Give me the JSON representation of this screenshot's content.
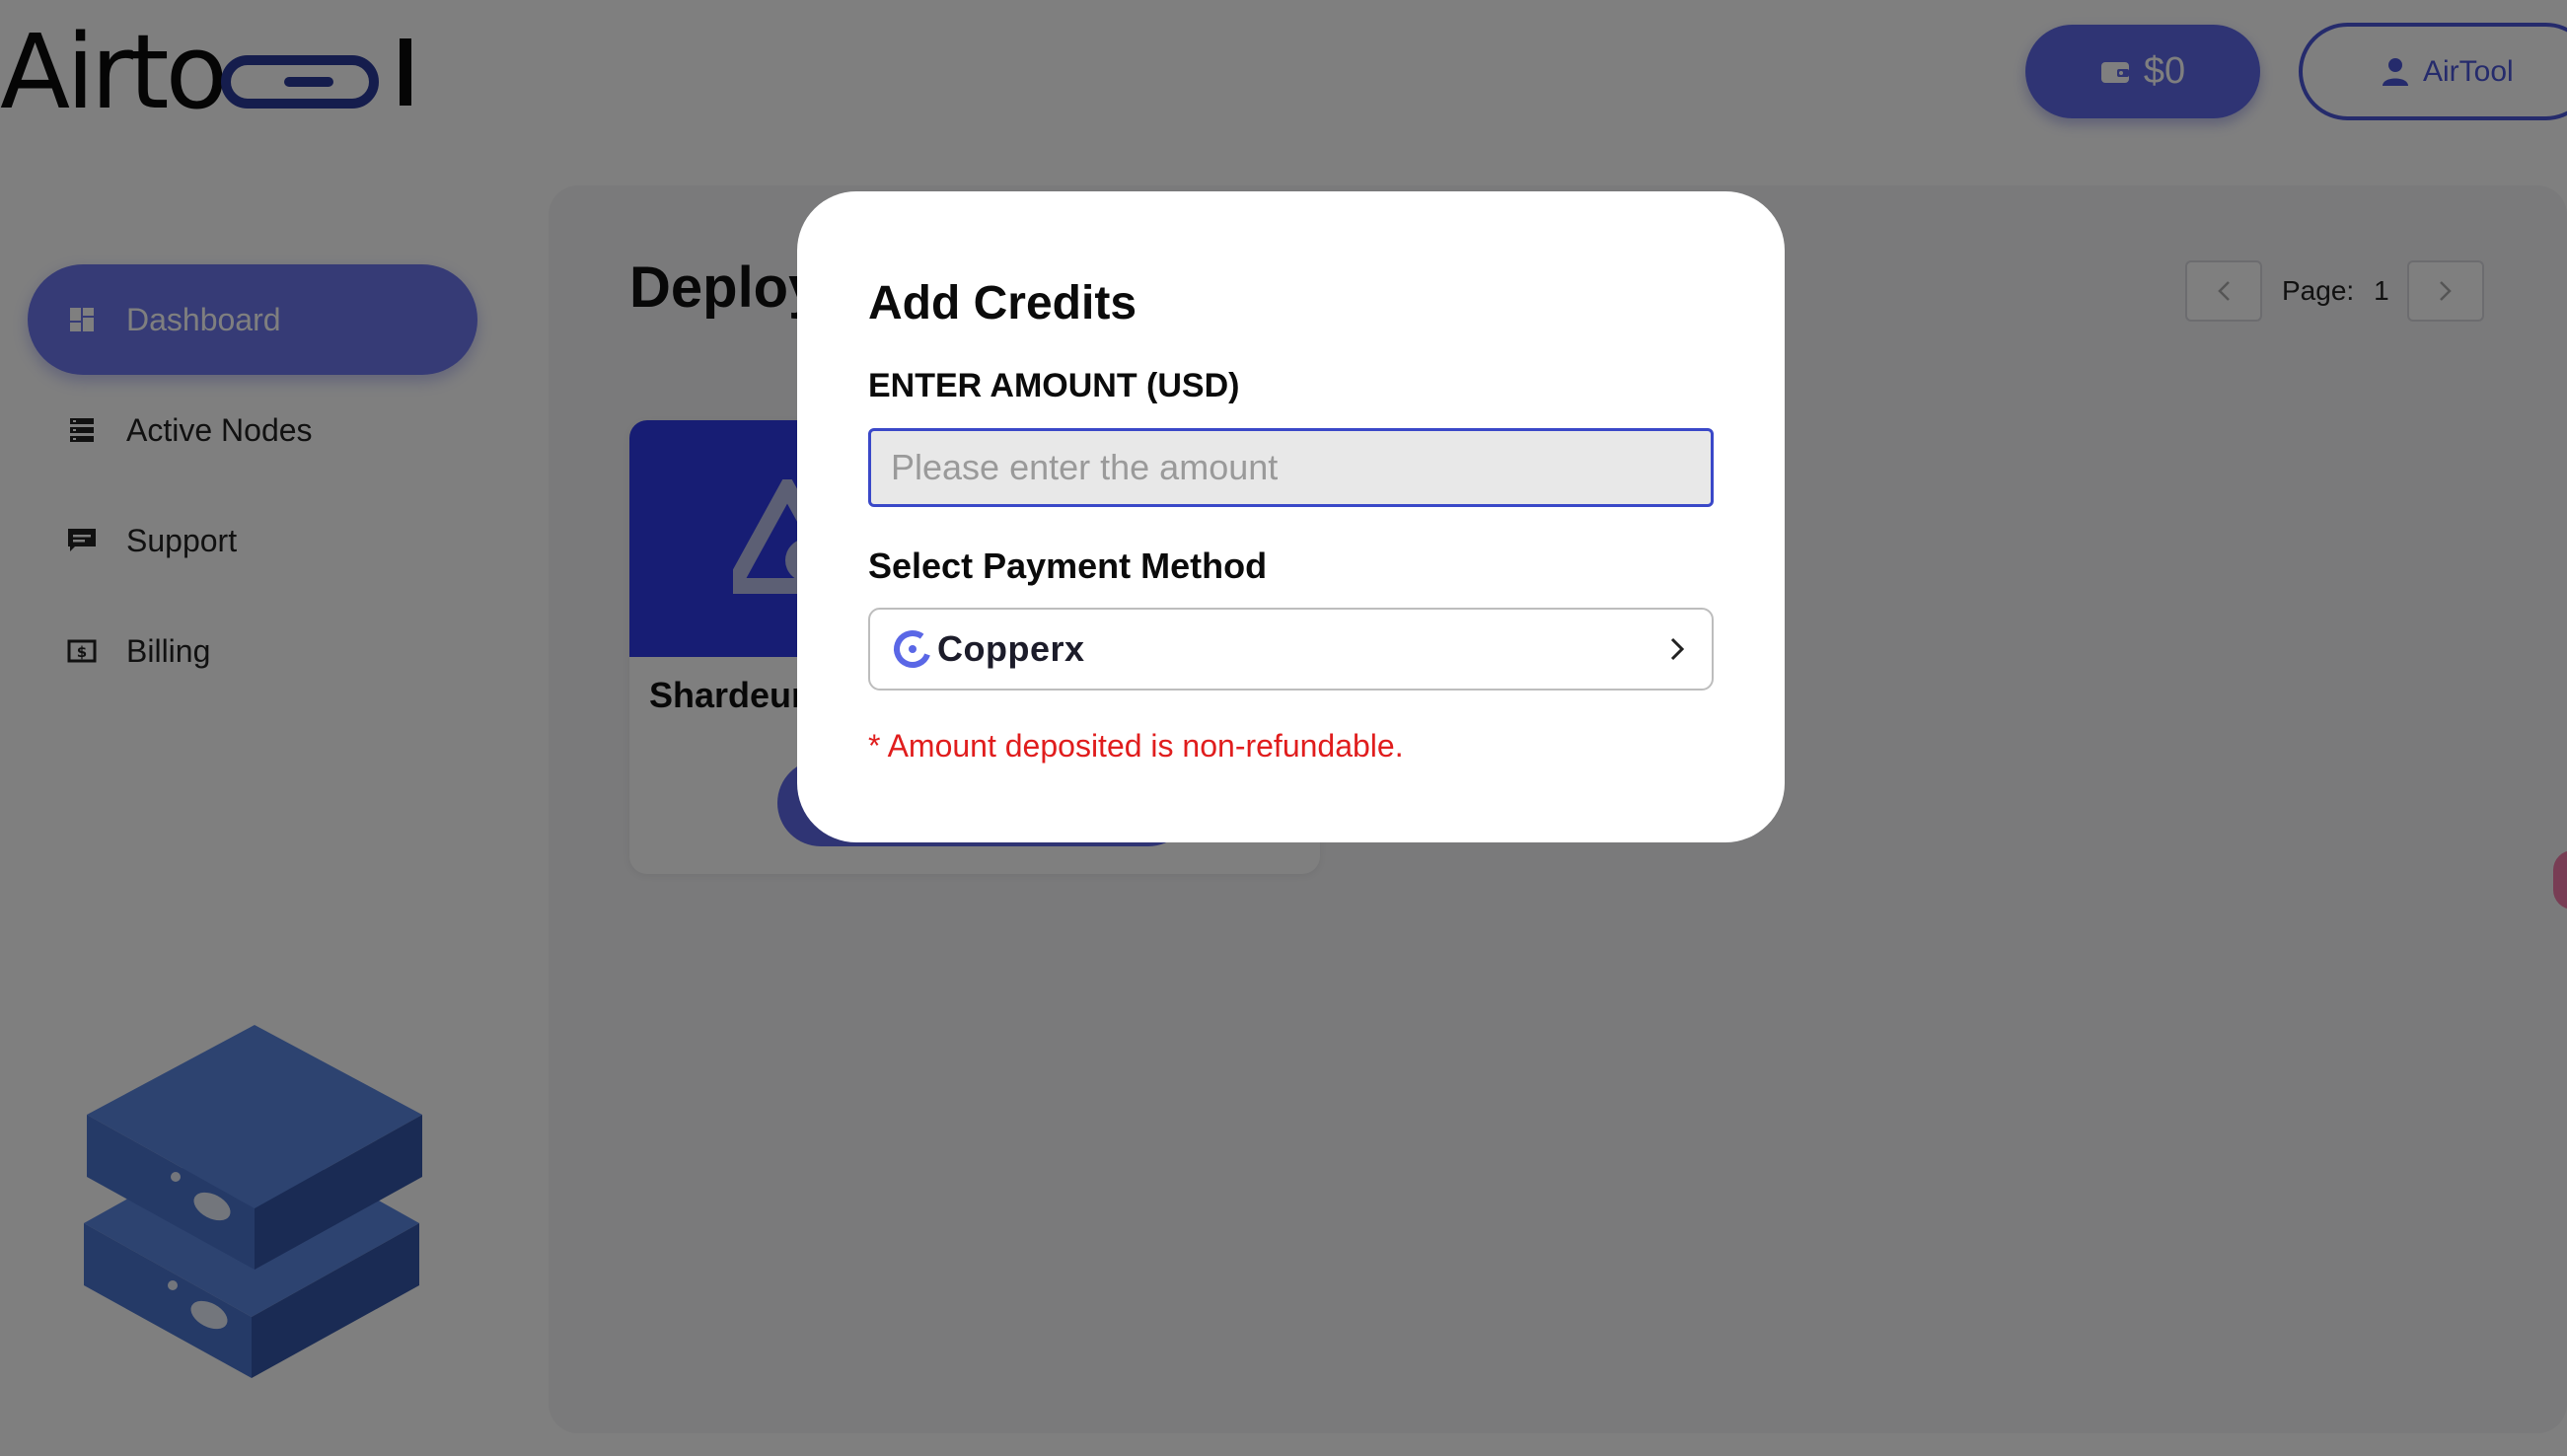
{
  "header": {
    "logo_text": "Airto",
    "wallet": {
      "icon": "wallet-icon",
      "balance": "$0"
    },
    "user": {
      "icon": "user-icon",
      "name": "AirTool"
    }
  },
  "sidebar": {
    "items": [
      {
        "label": "Dashboard",
        "icon": "dashboard-icon",
        "active": true
      },
      {
        "label": "Active Nodes",
        "icon": "server-list-icon",
        "active": false
      },
      {
        "label": "Support",
        "icon": "chat-icon",
        "active": false
      },
      {
        "label": "Billing",
        "icon": "dollar-bill-icon",
        "active": false
      }
    ]
  },
  "main": {
    "title": "Deploy",
    "pagination": {
      "label": "Page:",
      "current": "1"
    },
    "cards": [
      {
        "name": "Shardeur",
        "logo": "shardeum-triangle-logo"
      }
    ]
  },
  "modal": {
    "title": "Add Credits",
    "amount_label": "ENTER AMOUNT (USD)",
    "amount_placeholder": "Please enter the amount",
    "amount_value": "",
    "payment_label": "Select Payment Method",
    "payment_method": "Copperx",
    "notice": "* Amount deposited is non-refundable."
  },
  "colors": {
    "brand": "#5e68e8",
    "brand_dark": "#3a48c8",
    "error": "#e01d1d",
    "overlay": "rgba(0,0,0,0.5)"
  }
}
